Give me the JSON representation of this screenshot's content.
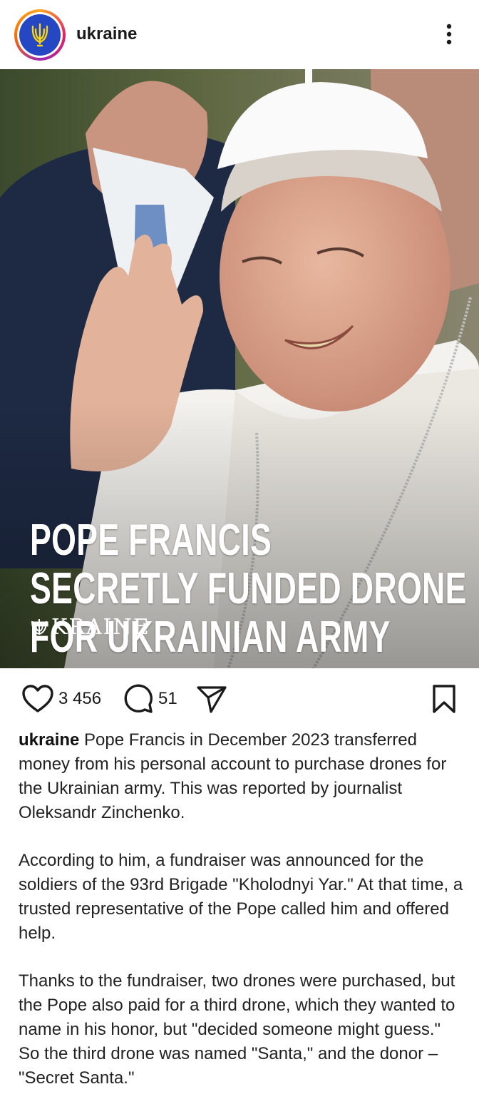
{
  "header": {
    "username": "ukraine",
    "avatar_icon": "trident-icon",
    "more_icon": "more-vertical-icon"
  },
  "post": {
    "headline": [
      "POPE FRANCIS",
      "SECRETLY FUNDED DRONE",
      "FOR UKRAINIAN ARMY"
    ],
    "watermark": "KRAINE",
    "watermark_icon": "trident-icon"
  },
  "actions": {
    "like_icon": "heart-icon",
    "likes": "3 456",
    "comment_icon": "comment-icon",
    "comments": "51",
    "share_icon": "send-icon",
    "save_icon": "bookmark-icon"
  },
  "caption": {
    "author": "ukraine",
    "paragraph1": "Pope Francis in December 2023 transferred money from his personal account to purchase drones for the Ukrainian army. This was reported by journalist Oleksandr Zinchenko.",
    "paragraph2": "According to him, a fundraiser was announced for the soldiers of the 93rd Brigade \"Kholodnyi Yar.\" At that time, a trusted representative of the Pope called him and offered help.",
    "paragraph3": "Thanks to the fundraiser, two drones were purchased, but the Pope also paid for a third drone, which they wanted to name in his honor, but \"decided someone might guess.\" So the third drone was named \"Santa,\" and the donor – \"Secret Santa.\""
  },
  "colors": {
    "avatar_blue": "#2547c4",
    "text": "#1a1a1a"
  }
}
